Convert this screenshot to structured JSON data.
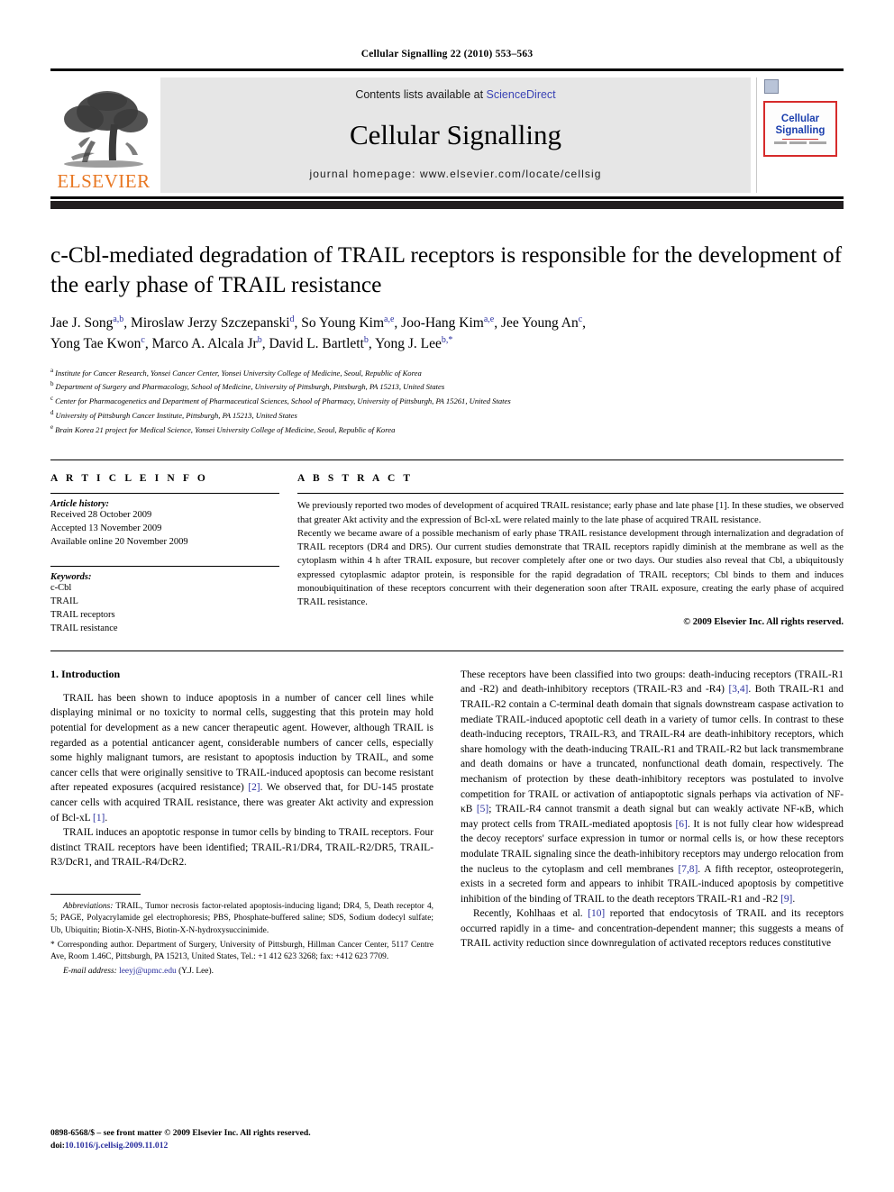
{
  "running_head": "Cellular Signalling 22 (2010) 553–563",
  "masthead": {
    "publisher": "ELSEVIER",
    "contents_prefix": "Contents lists available at ",
    "sciencedirect": "ScienceDirect",
    "journal_title": "Cellular Signalling",
    "homepage": "journal homepage: www.elsevier.com/locate/cellsig",
    "cover_title_line1": "Cellular",
    "cover_title_line2": "Signalling"
  },
  "article": {
    "title": "c-Cbl-mediated degradation of TRAIL receptors is responsible for the development of the early phase of TRAIL resistance",
    "authors": [
      {
        "name": "Jae J. Song",
        "markers": "a,b"
      },
      {
        "name": "Miroslaw Jerzy Szczepanski",
        "markers": "d"
      },
      {
        "name": "So Young Kim",
        "markers": "a,e"
      },
      {
        "name": "Joo-Hang Kim",
        "markers": "a,e"
      },
      {
        "name": "Jee Young An",
        "markers": "c"
      },
      {
        "name": "Yong Tae Kwon",
        "markers": "c"
      },
      {
        "name": "Marco A. Alcala Jr",
        "markers": "b"
      },
      {
        "name": "David L. Bartlett",
        "markers": "b"
      },
      {
        "name": "Yong J. Lee",
        "markers": "b,*"
      }
    ],
    "affiliations": [
      {
        "marker": "a",
        "text": "Institute for Cancer Research, Yonsei Cancer Center, Yonsei University College of Medicine, Seoul, Republic of Korea"
      },
      {
        "marker": "b",
        "text": "Department of Surgery and Pharmacology, School of Medicine, University of Pittsburgh, Pittsburgh, PA 15213, United States"
      },
      {
        "marker": "c",
        "text": "Center for Pharmacogenetics and Department of Pharmaceutical Sciences, School of Pharmacy, University of Pittsburgh, PA 15261, United States"
      },
      {
        "marker": "d",
        "text": "University of Pittsburgh Cancer Institute, Pittsburgh, PA 15213, United States"
      },
      {
        "marker": "e",
        "text": "Brain Korea 21 project for Medical Science, Yonsei University College of Medicine, Seoul, Republic of Korea"
      }
    ]
  },
  "article_info": {
    "section_label": "A R T I C L E   I N F O",
    "history_label": "Article history:",
    "history": [
      "Received 28 October 2009",
      "Accepted 13 November 2009",
      "Available online 20 November 2009"
    ],
    "keywords_label": "Keywords:",
    "keywords": [
      "c-Cbl",
      "TRAIL",
      "TRAIL receptors",
      "TRAIL resistance"
    ]
  },
  "abstract": {
    "section_label": "A B S T R A C T",
    "paragraph1": "We previously reported two modes of development of acquired TRAIL resistance; early phase and late phase [1]. In these studies, we observed that greater Akt activity and the expression of Bcl-xL were related mainly to the late phase of acquired TRAIL resistance.",
    "paragraph2": "Recently we became aware of a possible mechanism of early phase TRAIL resistance development through internalization and degradation of TRAIL receptors (DR4 and DR5). Our current studies demonstrate that TRAIL receptors rapidly diminish at the membrane as well as the cytoplasm within 4 h after TRAIL exposure, but recover completely after one or two days. Our studies also reveal that Cbl, a ubiquitously expressed cytoplasmic adaptor protein, is responsible for the rapid degradation of TRAIL receptors; Cbl binds to them and induces monoubiquitination of these receptors concurrent with their degeneration soon after TRAIL exposure, creating the early phase of acquired TRAIL resistance.",
    "copyright": "© 2009 Elsevier Inc. All rights reserved."
  },
  "introduction": {
    "heading": "1. Introduction",
    "left_para1_a": "TRAIL has been shown to induce apoptosis in a number of cancer cell lines while displaying minimal or no toxicity to normal cells, suggesting that this protein may hold potential for development as a new cancer therapeutic agent. However, although TRAIL is regarded as a potential anticancer agent, considerable numbers of cancer cells, especially some highly malignant tumors, are resistant to apoptosis induction by TRAIL, and some cancer cells that were originally sensitive to TRAIL-induced apoptosis can become resistant after repeated exposures (acquired resistance) ",
    "left_para1_ref1": "[2]",
    "left_para1_b": ". We observed that, for DU-145 prostate cancer cells with acquired TRAIL resistance, there was greater Akt activity and expression of Bcl-xL ",
    "left_para1_ref2": "[1]",
    "left_para1_c": ".",
    "left_para2": "TRAIL induces an apoptotic response in tumor cells by binding to TRAIL receptors. Four distinct TRAIL receptors have been identified; TRAIL-R1/DR4, TRAIL-R2/DR5, TRAIL-R3/DcR1, and TRAIL-R4/DcR2.",
    "right_para1_a": "These receptors have been classified into two groups: death-inducing receptors (TRAIL-R1 and -R2) and death-inhibitory receptors (TRAIL-R3 and -R4) ",
    "right_para1_ref1": "[3,4]",
    "right_para1_b": ". Both TRAIL-R1 and TRAIL-R2 contain a C-terminal death domain that signals downstream caspase activation to mediate TRAIL-induced apoptotic cell death in a variety of tumor cells. In contrast to these death-inducing receptors, TRAIL-R3, and TRAIL-R4 are death-inhibitory receptors, which share homology with the death-inducing TRAIL-R1 and TRAIL-R2 but lack transmembrane and death domains or have a truncated, nonfunctional death domain, respectively. The mechanism of protection by these death-inhibitory receptors was postulated to involve competition for TRAIL or activation of antiapoptotic signals perhaps via activation of NF-κB ",
    "right_para1_ref2": "[5]",
    "right_para1_c": "; TRAIL-R4 cannot transmit a death signal but can weakly activate NF-κB, which may protect cells from TRAIL-mediated apoptosis ",
    "right_para1_ref3": "[6]",
    "right_para1_d": ". It is not fully clear how widespread the decoy receptors' surface expression in tumor or normal cells is, or how these receptors modulate TRAIL signaling since the death-inhibitory receptors may undergo relocation from the nucleus to the cytoplasm and cell membranes ",
    "right_para1_ref4": "[7,8]",
    "right_para1_e": ". A fifth receptor, osteoprotegerin, exists in a secreted form and appears to inhibit TRAIL-induced apoptosis by competitive inhibition of the binding of TRAIL to the death receptors TRAIL-R1 and -R2 ",
    "right_para1_ref5": "[9]",
    "right_para1_f": ".",
    "right_para2_a": "Recently, Kohlhaas et al. ",
    "right_para2_ref1": "[10]",
    "right_para2_b": " reported that endocytosis of TRAIL and its receptors occurred rapidly in a time- and concentration-dependent manner; this suggests a means of TRAIL activity reduction since downregulation of activated receptors reduces constitutive"
  },
  "footnotes": {
    "abbreviations_label": "Abbreviations:",
    "abbreviations_text": " TRAIL, Tumor necrosis factor-related apoptosis-inducing ligand; DR4, 5, Death receptor 4, 5; PAGE, Polyacrylamide gel electrophoresis; PBS, Phosphate-buffered saline; SDS, Sodium dodecyl sulfate; Ub, Ubiquitin; Biotin-X-NHS, Biotin-X-N-hydroxysuccinimide.",
    "corresponding_marker": "*",
    "corresponding_text": " Corresponding author. Department of Surgery, University of Pittsburgh, Hillman Cancer Center, 5117 Centre Ave, Room 1.46C, Pittsburgh, PA 15213, United States, Tel.: +1 412 623 3268; fax: +412 623 7709.",
    "email_label": "E-mail address:",
    "email": "leeyj@upmc.edu",
    "email_owner": "(Y.J. Lee)."
  },
  "imprint": {
    "issn_line": "0898-6568/$ – see front matter © 2009 Elsevier Inc. All rights reserved.",
    "doi_label": "doi:",
    "doi": "10.1016/j.cellsig.2009.11.012"
  },
  "colors": {
    "link_blue": "#2a2f9e",
    "sciencedirect_blue": "#3a43b5",
    "elsevier_orange": "#E87722",
    "cover_red": "#d62b2b",
    "masthead_gray": "#e6e6e6"
  }
}
